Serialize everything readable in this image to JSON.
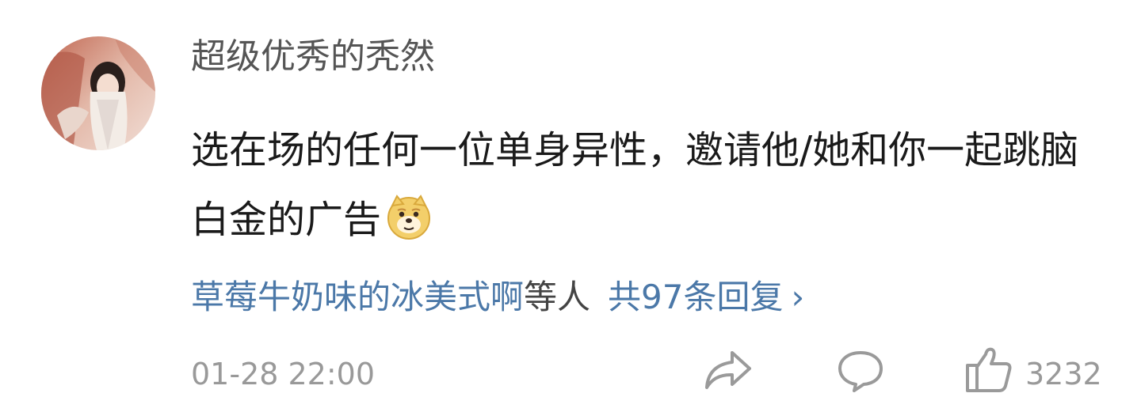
{
  "comment": {
    "username": "超级优秀的秃然",
    "text": "选在场的任何一位单身异性，邀请他/她和你一起跳脑白金的广告",
    "emoji": "doge-emoji",
    "replies": {
      "names": "草莓牛奶味的冰美式啊",
      "suffix": "等人",
      "total": "共97条回复",
      "chevron": "›"
    },
    "timestamp": "01-28 22:00",
    "actions": {
      "share_icon": "share-icon",
      "comment_icon": "comment-icon",
      "like_icon": "thumbs-up-icon",
      "like_count": "3232"
    }
  }
}
